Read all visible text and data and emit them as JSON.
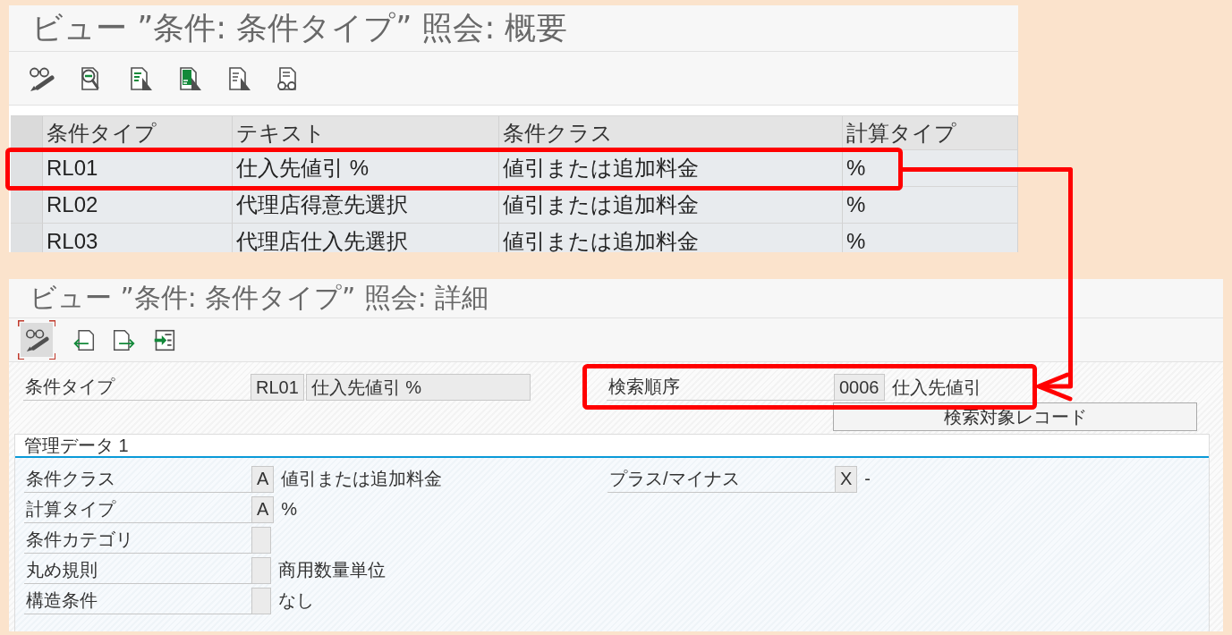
{
  "overview": {
    "title": "ビュー ”条件: 条件タイプ” 照会: 概要",
    "toolbar": [
      {
        "kind": "glasses"
      },
      {
        "kind": "search"
      },
      {
        "kind": "lines"
      },
      {
        "kind": "solid"
      },
      {
        "kind": "plain"
      },
      {
        "kind": "view"
      }
    ],
    "table": {
      "columns": [
        "条件タイプ",
        "テキスト",
        "条件クラス",
        "計算タイプ"
      ],
      "rows": [
        {
          "cells": [
            "RL01",
            "仕入先値引 %",
            "値引または追加料金",
            "%"
          ]
        },
        {
          "cells": [
            "RL02",
            "代理店得意先選択",
            "値引または追加料金",
            "%"
          ]
        },
        {
          "cells": [
            "RL03",
            "代理店仕入先選択",
            "値引または追加料金",
            "%"
          ]
        }
      ]
    }
  },
  "detail": {
    "title": "ビュー ”条件: 条件タイプ” 照会: 詳細",
    "toolbar": [
      {
        "kind": "glasses",
        "pressed": true
      },
      {
        "kind": "previous",
        "pressed": false
      },
      {
        "kind": "next",
        "pressed": false
      },
      {
        "kind": "other",
        "pressed": false
      }
    ],
    "header_fields": [
      {
        "kind": "boxed",
        "label": "条件タイプ",
        "code": "RL01",
        "text": "仕入先値引 %"
      },
      {
        "kind": "plain",
        "label": "検索順序",
        "code": "0006",
        "text": "仕入先値引"
      }
    ],
    "button": "検索対象レコード",
    "group": {
      "title": "管理データ 1",
      "left": [
        {
          "label": "条件クラス",
          "code": "A",
          "text": "値引または追加料金"
        },
        {
          "label": "計算タイプ",
          "code": "A",
          "text": "%"
        },
        {
          "label": "条件カテゴリ"
        },
        {
          "label": "丸め規則",
          "text": "商用数量単位"
        },
        {
          "label": "構造条件",
          "text": "なし"
        }
      ],
      "right": [
        {
          "label": "プラス/マイナス",
          "code": "X",
          "text": "-"
        }
      ]
    }
  }
}
